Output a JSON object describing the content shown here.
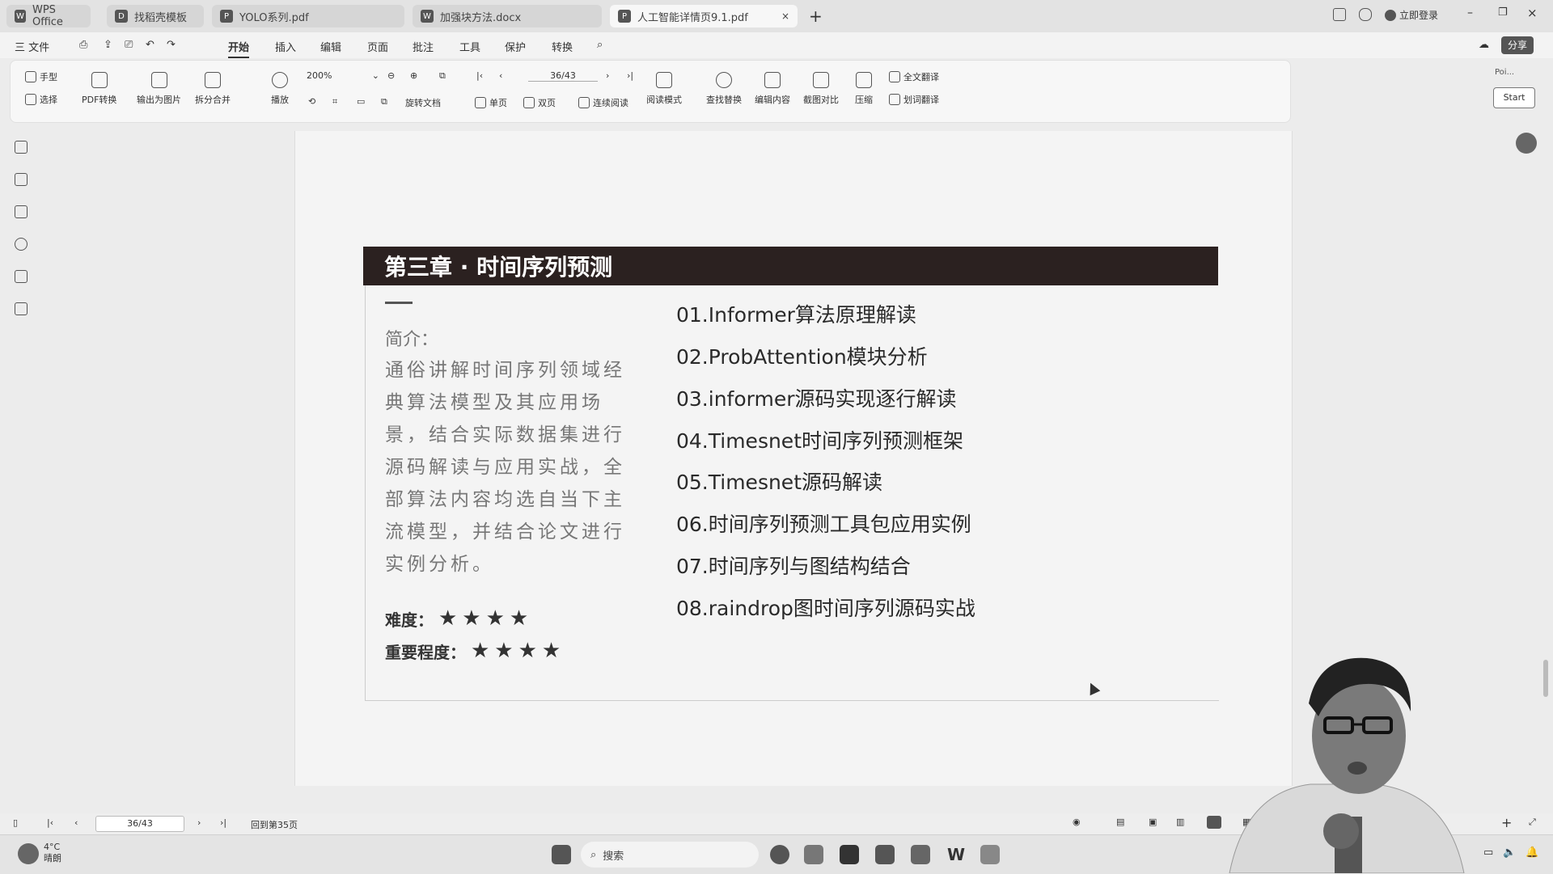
{
  "titlebar": {
    "tabs": [
      {
        "label": "WPS Office",
        "icon": "wps-logo-icon"
      },
      {
        "label": "找稻壳模板",
        "icon": "docer-icon"
      },
      {
        "label": "YOLO系列.pdf",
        "icon": "pdf-icon"
      },
      {
        "label": "加强块方法.docx",
        "icon": "word-icon"
      },
      {
        "label": "人工智能详情页9.1.pdf",
        "icon": "pdf-icon"
      }
    ],
    "login_label": "立即登录"
  },
  "menu": {
    "file_label": "三 文件",
    "items": [
      "开始",
      "插入",
      "编辑",
      "页面",
      "批注",
      "工具",
      "保护",
      "转换"
    ],
    "active": "开始",
    "share_label": "分享"
  },
  "ribbon": {
    "hand_tool": "手型",
    "select_tool": "选择",
    "pdf_convert": "PDF转换",
    "export_image": "输出为图片",
    "split_merge": "拆分合并",
    "play": "播放",
    "zoom_value": "200%",
    "page_value": "36/43",
    "rotate_doc": "旋转文档",
    "single_page": "单页",
    "double_page": "双页",
    "continuous_read": "连续阅读",
    "read_mode": "阅读模式",
    "find_replace": "查找替换",
    "edit_content": "编辑内容",
    "screenshot_compare": "截图对比",
    "compress": "压缩",
    "full_translate": "全文翻译",
    "word_translate": "划词翻译",
    "side_label": "Poi...",
    "start_button": "Start"
  },
  "slide": {
    "header": "第三章 · 时间序列预测",
    "intro_title": "简介：",
    "intro_text": "通俗讲解时间序列领域经典算法模型及其应用场景，结合实际数据集进行源码解读与应用实战，全部算法内容均选自当下主流模型，并结合论文进行实例分析。",
    "difficulty_label": "难度：",
    "difficulty_stars": "★★★★",
    "importance_label": "重要程度：",
    "importance_stars": "★★★★",
    "toc": [
      "01.Informer算法原理解读",
      "02.ProbAttention模块分析",
      "03.informer源码实现逐行解读",
      "04.Timesnet时间序列预测框架",
      "05.Timesnet源码解读",
      "06.时间序列预测工具包应用实例",
      "07.时间序列与图结构结合",
      "08.raindrop图时间序列源码实战"
    ]
  },
  "statusbar": {
    "page_value": "36/43",
    "back_label": "回到第35页"
  },
  "taskbar": {
    "weather_temp": "4°C",
    "weather_desc": "晴朗",
    "search_placeholder": "搜索"
  }
}
